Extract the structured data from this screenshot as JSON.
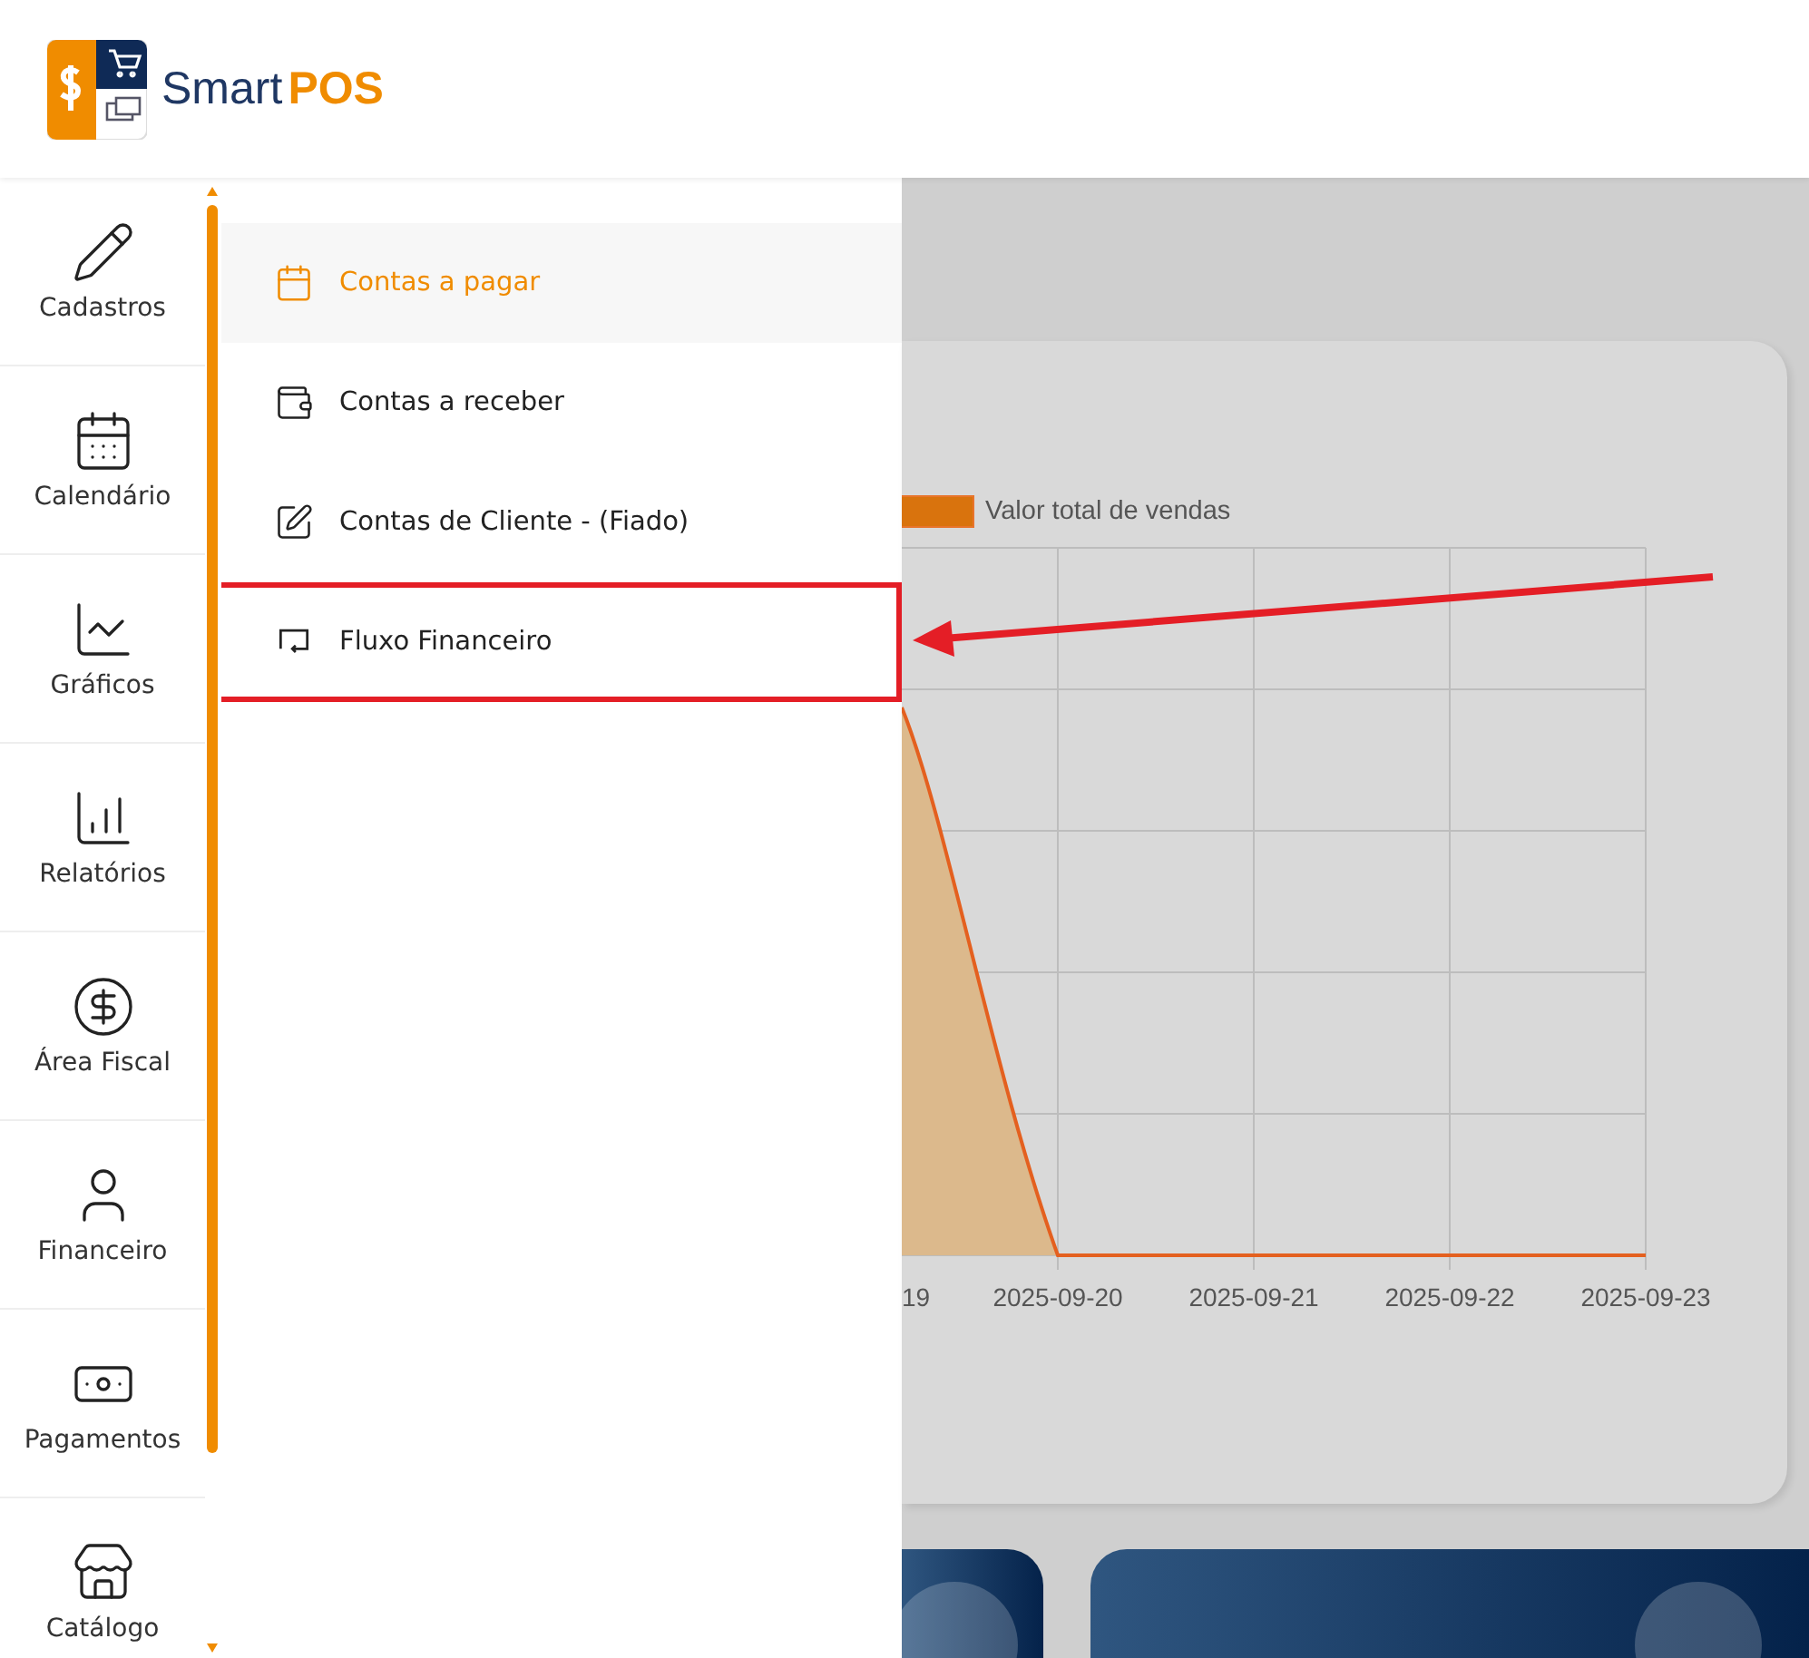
{
  "brand": {
    "name": "Smart",
    "accent": "POS"
  },
  "sidebar": {
    "items": [
      {
        "label": "Cadastros",
        "kind": "pencil"
      },
      {
        "label": "Calendário",
        "kind": "calendar"
      },
      {
        "label": "Gráficos",
        "kind": "line"
      },
      {
        "label": "Relatórios",
        "kind": "bars"
      },
      {
        "label": "Área Fiscal",
        "kind": "dollar"
      },
      {
        "label": "Financeiro",
        "kind": "person"
      },
      {
        "label": "Pagamentos",
        "kind": "bill"
      },
      {
        "label": "Catálogo",
        "kind": "store"
      }
    ]
  },
  "submenu": {
    "items": [
      {
        "label": "Contas a pagar",
        "kind": "calendar",
        "selected": true,
        "highlighted": false
      },
      {
        "label": "Contas a receber",
        "kind": "wallet",
        "selected": false,
        "highlighted": false
      },
      {
        "label": "Contas de Cliente - (Fiado)",
        "kind": "edit",
        "selected": false,
        "highlighted": false
      },
      {
        "label": "Fluxo Financeiro",
        "kind": "flow",
        "selected": false,
        "highlighted": true
      }
    ]
  },
  "chart": {
    "legend": "Valor total de vendas",
    "x_labels": [
      "19",
      "2025-09-20",
      "2025-09-21",
      "2025-09-22",
      "2025-09-23"
    ]
  },
  "annotation": {
    "kind": "arrow"
  }
}
